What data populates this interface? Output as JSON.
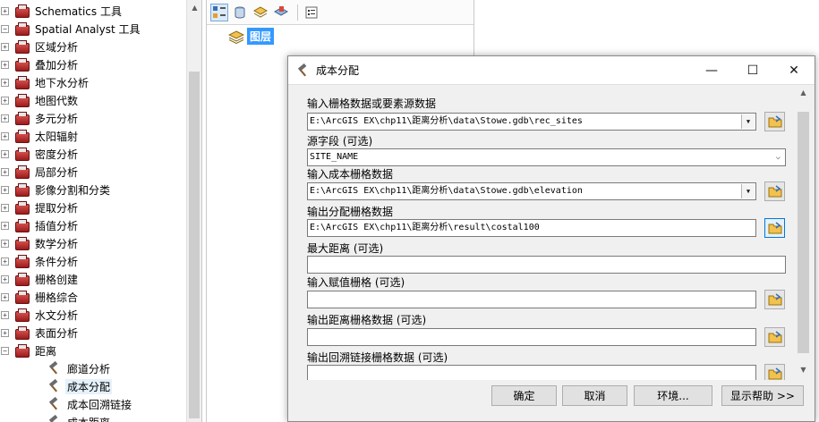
{
  "tree": {
    "items": [
      {
        "label": "Schematics 工具",
        "level": 0,
        "expander": "+",
        "icon": "toolbox-icon"
      },
      {
        "label": "Spatial Analyst 工具",
        "level": 0,
        "expander": "−",
        "icon": "toolbox-icon"
      },
      {
        "label": "区域分析",
        "level": 1,
        "expander": "+",
        "icon": "toolbox-icon"
      },
      {
        "label": "叠加分析",
        "level": 1,
        "expander": "+",
        "icon": "toolbox-icon"
      },
      {
        "label": "地下水分析",
        "level": 1,
        "expander": "+",
        "icon": "toolbox-icon"
      },
      {
        "label": "地图代数",
        "level": 1,
        "expander": "+",
        "icon": "toolbox-icon"
      },
      {
        "label": "多元分析",
        "level": 1,
        "expander": "+",
        "icon": "toolbox-icon"
      },
      {
        "label": "太阳辐射",
        "level": 1,
        "expander": "+",
        "icon": "toolbox-icon"
      },
      {
        "label": "密度分析",
        "level": 1,
        "expander": "+",
        "icon": "toolbox-icon"
      },
      {
        "label": "局部分析",
        "level": 1,
        "expander": "+",
        "icon": "toolbox-icon"
      },
      {
        "label": "影像分割和分类",
        "level": 1,
        "expander": "+",
        "icon": "toolbox-icon"
      },
      {
        "label": "提取分析",
        "level": 1,
        "expander": "+",
        "icon": "toolbox-icon"
      },
      {
        "label": "插值分析",
        "level": 1,
        "expander": "+",
        "icon": "toolbox-icon"
      },
      {
        "label": "数学分析",
        "level": 1,
        "expander": "+",
        "icon": "toolbox-icon"
      },
      {
        "label": "条件分析",
        "level": 1,
        "expander": "+",
        "icon": "toolbox-icon"
      },
      {
        "label": "栅格创建",
        "level": 1,
        "expander": "+",
        "icon": "toolbox-icon"
      },
      {
        "label": "栅格综合",
        "level": 1,
        "expander": "+",
        "icon": "toolbox-icon"
      },
      {
        "label": "水文分析",
        "level": 1,
        "expander": "+",
        "icon": "toolbox-icon"
      },
      {
        "label": "表面分析",
        "level": 1,
        "expander": "+",
        "icon": "toolbox-icon"
      },
      {
        "label": "距离",
        "level": 1,
        "expander": "−",
        "icon": "toolbox-icon"
      },
      {
        "label": "廊道分析",
        "level": 2,
        "expander": "",
        "icon": "hammer-icon"
      },
      {
        "label": "成本分配",
        "level": 2,
        "expander": "",
        "icon": "hammer-icon",
        "selected": true
      },
      {
        "label": "成本回溯链接",
        "level": 2,
        "expander": "",
        "icon": "hammer-icon"
      },
      {
        "label": "成本距离",
        "level": 2,
        "expander": "",
        "icon": "hammer-icon"
      }
    ]
  },
  "toc": {
    "layers_label": "图层"
  },
  "dialog": {
    "title": "成本分配",
    "controls": {
      "minimize": "—",
      "maximize": "☐",
      "close": "✕"
    },
    "fields": [
      {
        "label": "输入栅格数据或要素源数据",
        "value": "E:\\ArcGIS EX\\chp11\\距离分析\\data\\Stowe.gdb\\rec_sites",
        "kind": "combo",
        "has_browse": true
      },
      {
        "label": "源字段 (可选)",
        "value": "SITE_NAME",
        "kind": "chevron",
        "has_browse": false
      },
      {
        "label": "输入成本栅格数据",
        "value": "E:\\ArcGIS EX\\chp11\\距离分析\\data\\Stowe.gdb\\elevation",
        "kind": "combo",
        "has_browse": true
      },
      {
        "label": "输出分配栅格数据",
        "value": "E:\\ArcGIS EX\\chp11\\距离分析\\result\\costal100",
        "kind": "text",
        "has_browse": true,
        "focused": true
      },
      {
        "label": "最大距离 (可选)",
        "value": "",
        "kind": "text-wide",
        "has_browse": false
      },
      {
        "label": "输入赋值栅格 (可选)",
        "value": "",
        "kind": "text",
        "has_browse": true
      },
      {
        "label": "输出距离栅格数据 (可选)",
        "value": "",
        "kind": "text",
        "has_browse": true
      },
      {
        "label": "输出回溯链接栅格数据 (可选)",
        "value": "",
        "kind": "text",
        "has_browse": true
      }
    ],
    "buttons": {
      "ok": "确定",
      "cancel": "取消",
      "environments": "环境...",
      "show_help": "显示帮助 >>"
    }
  },
  "colors": {
    "accent": "#3399ff",
    "selected_bg": "#e5f1fb",
    "dialog_bg": "#f0f0f0"
  }
}
